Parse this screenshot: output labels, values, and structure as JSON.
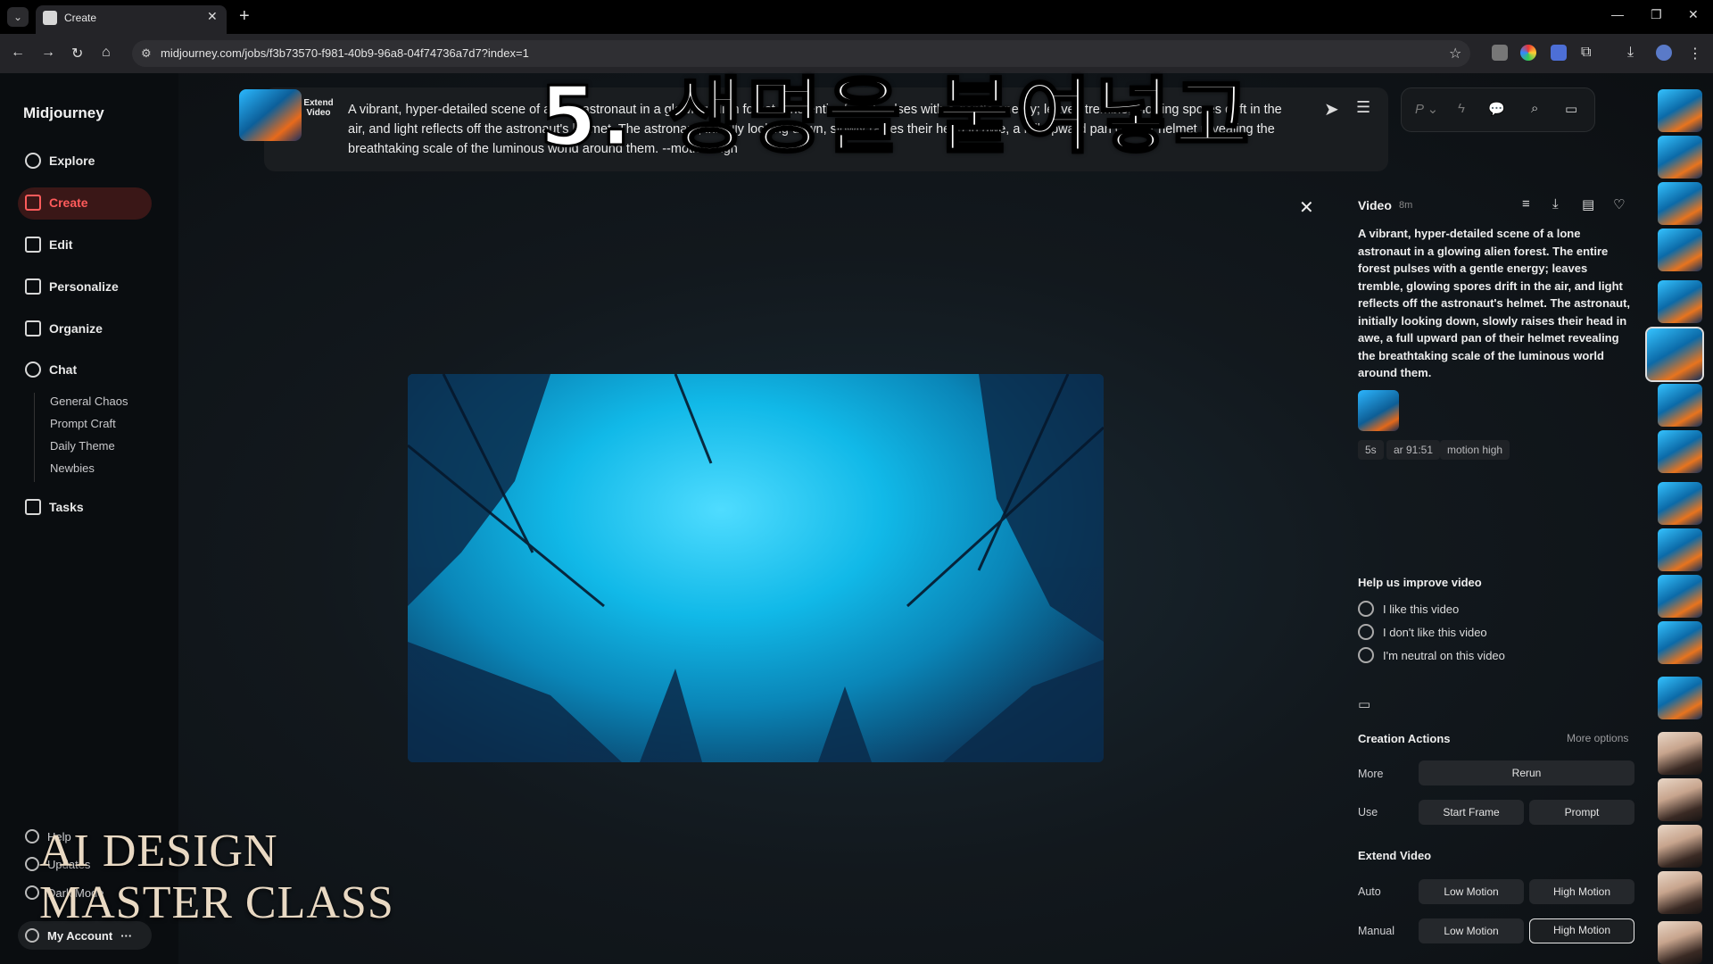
{
  "browser": {
    "tab_title": "Create",
    "url": "midjourney.com/jobs/f3b73570-f981-40b9-96a8-04f74736a7d7?index=1"
  },
  "sidebar": {
    "brand": "Midjourney",
    "nav": [
      {
        "label": "Explore",
        "icon": "compass-icon"
      },
      {
        "label": "Create",
        "icon": "brush-icon"
      },
      {
        "label": "Edit",
        "icon": "edit-icon"
      },
      {
        "label": "Personalize",
        "icon": "personalize-icon"
      },
      {
        "label": "Organize",
        "icon": "image-icon"
      },
      {
        "label": "Chat",
        "icon": "chat-icon"
      }
    ],
    "chat_rooms": [
      "General Chaos",
      "Prompt Craft",
      "Daily Theme",
      "Newbies"
    ],
    "tasks": "Tasks",
    "bottom": {
      "help": "Help",
      "updates": "Updates",
      "dark_mode": "Dark Mode",
      "account": "My Account",
      "account_more": "···"
    }
  },
  "prompt_bar": {
    "mode_label": "Extend Video",
    "text": "A vibrant, hyper-detailed scene of a lone astronaut in a glowing alien forest. The entire forest pulses with a gentle energy; leaves tremble, glowing spores drift in the air, and light reflects off the astronaut's helmet. The astronaut, initially looking down, slowly raises their head in awe, a full upward pan of their helmet revealing the breathtaking scale of the luminous world around them. --motion high"
  },
  "overlay": {
    "caption": "5. 생명을 붙여넣고",
    "watermark_line1": "AI DESIGN",
    "watermark_line2": "MASTER CLASS"
  },
  "detail_panel": {
    "title": "Video",
    "age": "8m",
    "description": "A vibrant, hyper-detailed scene of a lone astronaut in a glowing alien forest. The entire forest pulses with a gentle energy; leaves tremble, glowing spores drift in the air, and light reflects off the astronaut's helmet. The astronaut, initially looking down, slowly raises their head in awe, a full upward pan of their helmet revealing the breathtaking scale of the luminous world around them.",
    "tags": [
      "5s",
      "ar 91:51",
      "motion high"
    ],
    "feedback": {
      "title": "Help us improve video",
      "options": [
        "I like this video",
        "I don't like this video",
        "I'm neutral on this video"
      ]
    },
    "creation_actions": {
      "title": "Creation Actions",
      "more_options": "More options",
      "more_label": "More",
      "rerun": "Rerun",
      "use_label": "Use",
      "start_frame": "Start Frame",
      "prompt": "Prompt"
    },
    "extend_video": {
      "title": "Extend Video",
      "auto_label": "Auto",
      "manual_label": "Manual",
      "low_motion": "Low Motion",
      "high_motion": "High Motion"
    }
  },
  "colors": {
    "accent_red": "#ff5b5b",
    "background": "#0b0b0d",
    "video_cyan": "#11b9e8"
  }
}
